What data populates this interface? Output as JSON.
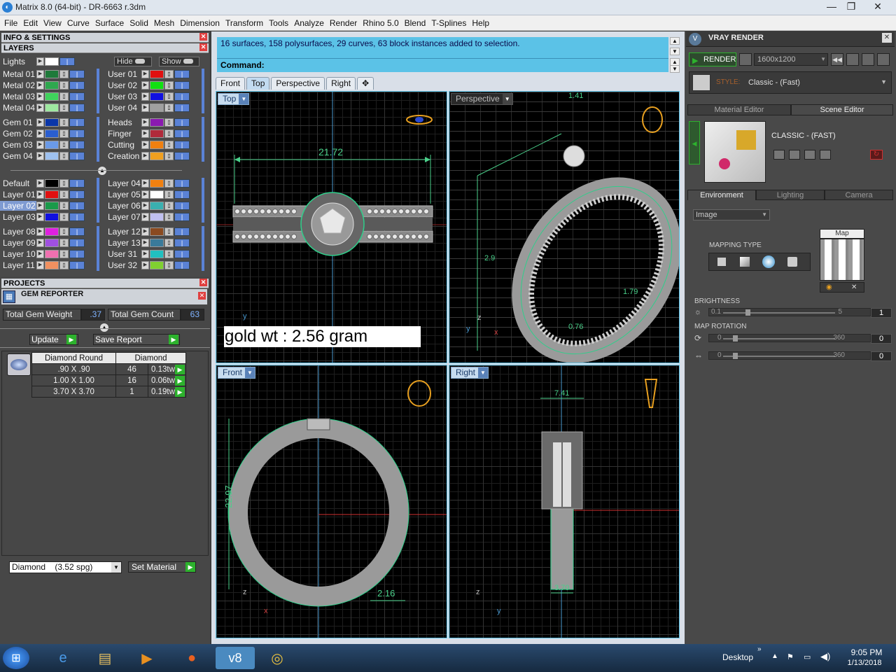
{
  "window": {
    "title": "Matrix 8.0 (64-bit) - DR-6663 r.3dm",
    "minimize": "—",
    "restore": "❐",
    "close": "✕"
  },
  "menu": [
    "File",
    "Edit",
    "View",
    "Curve",
    "Surface",
    "Solid",
    "Mesh",
    "Dimension",
    "Transform",
    "Tools",
    "Analyze",
    "Render",
    "Rhino 5.0",
    "Blend",
    "T-Splines",
    "Help"
  ],
  "panels": {
    "info": "INFO & SETTINGS",
    "layers": "LAYERS",
    "projects": "PROJECTS",
    "gem_reporter": "GEM REPORTER"
  },
  "layers": {
    "lights": "Lights",
    "hide": "Hide",
    "show": "Show",
    "left": [
      {
        "name": "Metal 01",
        "color": "#1e7a3a"
      },
      {
        "name": "Metal 02",
        "color": "#2ea84e"
      },
      {
        "name": "Metal 03",
        "color": "#3fd35c"
      },
      {
        "name": "Metal 04",
        "color": "#9ee8a0"
      },
      {
        "name": "Gem 01",
        "color": "#0a36a8"
      },
      {
        "name": "Gem 02",
        "color": "#2a5ed0"
      },
      {
        "name": "Gem 03",
        "color": "#6a9ae8"
      },
      {
        "name": "Gem 04",
        "color": "#9ec1f0"
      },
      {
        "name": "Default",
        "color": "#000000"
      },
      {
        "name": "Layer 01",
        "color": "#e01010"
      },
      {
        "name": "Layer 02",
        "color": "#1a9a4a",
        "selected": true
      },
      {
        "name": "Layer 03",
        "color": "#1010e0"
      },
      {
        "name": "Layer 08",
        "color": "#e020e0"
      },
      {
        "name": "Layer 09",
        "color": "#a050e0"
      },
      {
        "name": "Layer 10",
        "color": "#f070b0"
      },
      {
        "name": "Layer 11",
        "color": "#f09060"
      }
    ],
    "right": [
      {
        "name": "User 01",
        "color": "#e01010"
      },
      {
        "name": "User 02",
        "color": "#10e010"
      },
      {
        "name": "User 03",
        "color": "#1010e0"
      },
      {
        "name": "User 04",
        "color": "#a0a0a0"
      },
      {
        "name": "Heads",
        "color": "#8a1ab0"
      },
      {
        "name": "Finger",
        "color": "#b02a3a"
      },
      {
        "name": "Cutting",
        "color": "#f08010"
      },
      {
        "name": "Creation",
        "color": "#f0a020"
      },
      {
        "name": "Layer 04",
        "color": "#f08010"
      },
      {
        "name": "Layer 05",
        "color": "#ffffff"
      },
      {
        "name": "Layer 06",
        "color": "#3ab0b0"
      },
      {
        "name": "Layer 07",
        "color": "#c0c0f0"
      },
      {
        "name": "Layer 12",
        "color": "#8a4a20"
      },
      {
        "name": "Layer 13",
        "color": "#3a7a9a"
      },
      {
        "name": "User 31",
        "color": "#20c0c0"
      },
      {
        "name": "User 32",
        "color": "#80d030"
      }
    ]
  },
  "gem": {
    "weight_label": "Total Gem Weight",
    "weight": ".37",
    "count_label": "Total Gem Count",
    "count": "63",
    "update": "Update",
    "save_report": "Save Report",
    "col1": "Diamond Round",
    "col2": "Diamond",
    "rows": [
      {
        "size": ".90 X .90",
        "qty": "46",
        "tw": "0.13tw"
      },
      {
        "size": "1.00 X 1.00",
        "qty": "16",
        "tw": "0.06tw"
      },
      {
        "size": "3.70 X 3.70",
        "qty": "1",
        "tw": "0.19tw"
      }
    ],
    "material": "Diamond    (3.52 spg)",
    "set_material": "Set Material"
  },
  "command": {
    "history": "16 surfaces, 158 polysurfaces, 29 curves, 63 block instances added to selection.",
    "prompt": "Command:"
  },
  "view_tabs": [
    "Front",
    "Top",
    "Perspective",
    "Right",
    "✥"
  ],
  "active_tab": "Top",
  "viewports": {
    "top": {
      "label": "Top",
      "dim": "21.72",
      "axis": "y"
    },
    "perspective": {
      "label": "Perspective",
      "dims": [
        "1.41",
        "2.9",
        "0.76",
        "1.79"
      ],
      "axes": [
        "z",
        "y",
        "x"
      ]
    },
    "front": {
      "label": "Front",
      "dims": [
        "22.97",
        "2.16"
      ],
      "axes": [
        "z",
        "x"
      ]
    },
    "right": {
      "label": "Right",
      "dims": [
        "7.41",
        "3.70"
      ],
      "axes": [
        "z",
        "y"
      ]
    }
  },
  "gold_weight": "gold wt : 2.56 gram",
  "vray": {
    "title": "VRAY RENDER",
    "render": "RENDER",
    "resolution": "1600x1200",
    "style_label": "STYLE:",
    "style_value": "Classic - (Fast)",
    "tab_material": "Material Editor",
    "tab_scene": "Scene Editor",
    "preset_name": "CLASSIC - (FAST)",
    "sub_tabs": [
      "Environment",
      "Lighting",
      "Camera"
    ],
    "env_type": "Image",
    "map_label": "Map",
    "mapping_type": "MAPPING TYPE",
    "brightness_label": "BRIGHTNESS",
    "brightness_min": "0.1",
    "brightness_max": "5",
    "brightness_value": "1",
    "rotation_label": "MAP ROTATION",
    "rot1_min": "0",
    "rot1_max": "360",
    "rot1_value": "0",
    "rot2_min": "0",
    "rot2_max": "360",
    "rot2_value": "0",
    "map_close": "✕"
  },
  "taskbar": {
    "desktop": "Desktop",
    "time": "9:05 PM",
    "date": "1/13/2018"
  }
}
